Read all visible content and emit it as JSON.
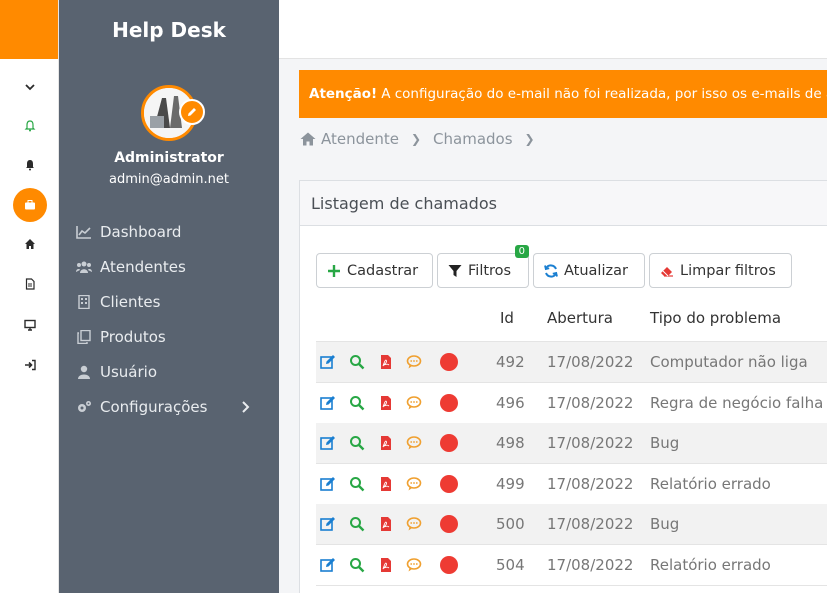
{
  "brand": "Help Desk",
  "user": {
    "name": "Administrator",
    "email": "admin@admin.net"
  },
  "nav": [
    {
      "label": "Dashboard",
      "icon": "chart-line-icon"
    },
    {
      "label": "Atendentes",
      "icon": "users-icon"
    },
    {
      "label": "Clientes",
      "icon": "building-icon"
    },
    {
      "label": "Produtos",
      "icon": "copy-icon"
    },
    {
      "label": "Usuário",
      "icon": "user-icon"
    },
    {
      "label": "Configurações",
      "icon": "cogs-icon"
    }
  ],
  "rail": [
    "chevron-down-icon",
    "bell-outline-icon",
    "bell-icon",
    "briefcase-icon",
    "home-icon",
    "file-icon",
    "desktop-icon",
    "sign-out-icon"
  ],
  "alert": {
    "strong": "Atenção!",
    "text": "A configuração do e-mail não foi realizada, por isso os e-mails de abertura de chamados não estão sendo enviados."
  },
  "breadcrumb": [
    "Atendente",
    "Chamados"
  ],
  "card": {
    "title": "Listagem de chamados"
  },
  "buttons": {
    "create": "Cadastrar",
    "filters": "Filtros",
    "filters_badge": "0",
    "refresh": "Atualizar",
    "clear": "Limpar filtros"
  },
  "columns": {
    "id": "Id",
    "opened": "Abertura",
    "type": "Tipo do problema"
  },
  "rows": [
    {
      "id": "492",
      "date": "17/08/2022",
      "type": "Computador não liga"
    },
    {
      "id": "496",
      "date": "17/08/2022",
      "type": "Regra de negócio falha"
    },
    {
      "id": "498",
      "date": "17/08/2022",
      "type": "Bug"
    },
    {
      "id": "499",
      "date": "17/08/2022",
      "type": "Relatório errado"
    },
    {
      "id": "500",
      "date": "17/08/2022",
      "type": "Bug"
    },
    {
      "id": "504",
      "date": "17/08/2022",
      "type": "Relatório errado"
    }
  ],
  "colors": {
    "accent": "#ff8a00",
    "sidebar": "#596370",
    "status_red": "#ee3b33",
    "edit_blue": "#1a7fd1",
    "search_green": "#28a745",
    "pdf_red": "#e53935",
    "chat_orange": "#f0a030"
  }
}
